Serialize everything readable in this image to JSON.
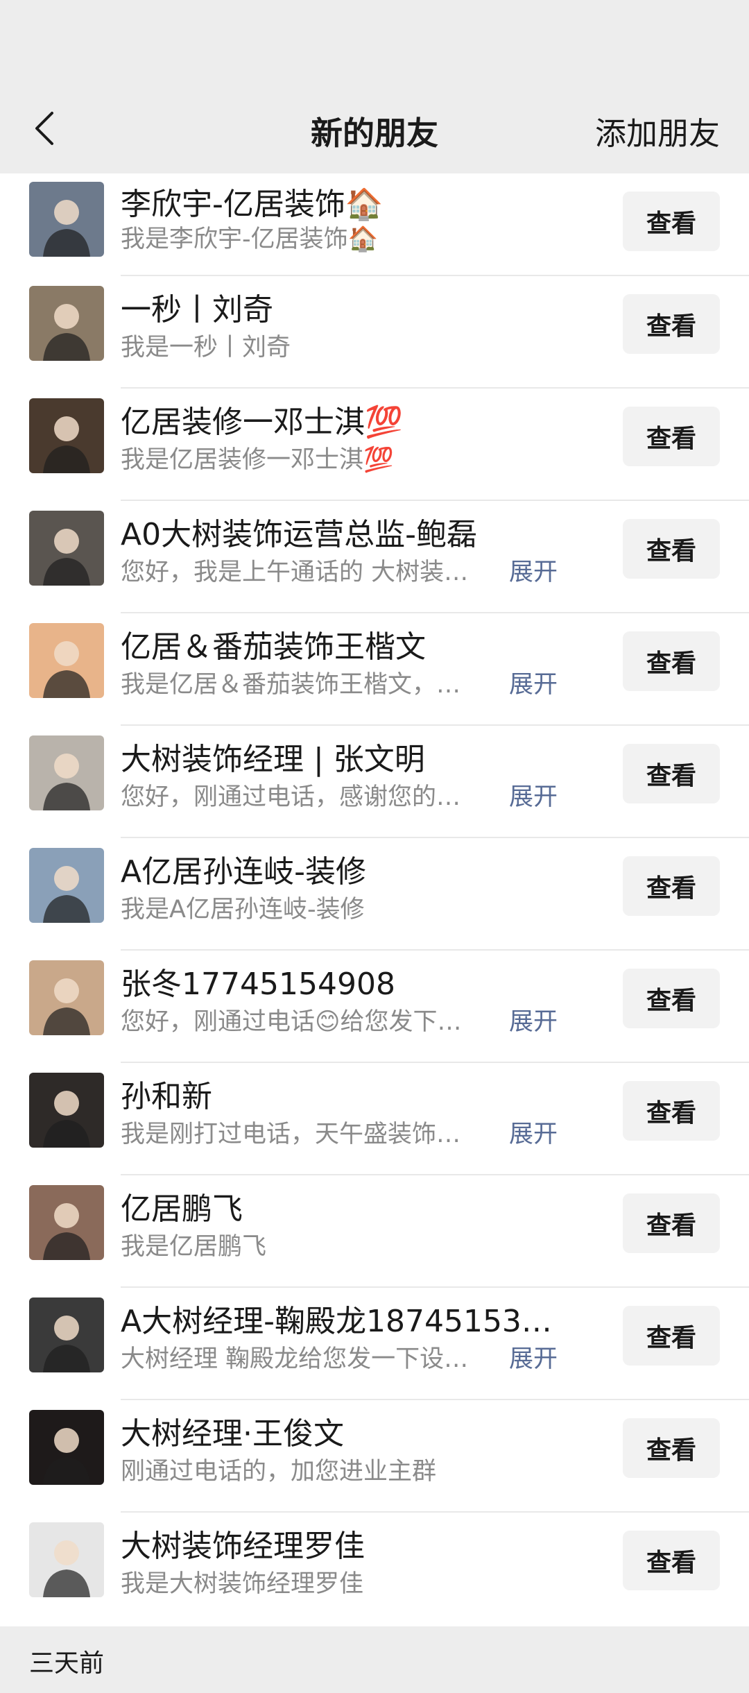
{
  "header": {
    "title": "新的朋友",
    "add_friend_label": "添加朋友"
  },
  "list": {
    "items": [
      {
        "name": "李欣宇-亿居装饰🏠",
        "message": "我是李欣宇-亿居装饰🏠",
        "expand": "",
        "button": "查看",
        "avatar_color": "#6d7a8c"
      },
      {
        "name": "一秒丨刘奇",
        "message": "我是一秒丨刘奇",
        "expand": "",
        "button": "查看",
        "avatar_color": "#8a7a66"
      },
      {
        "name": "亿居装修一邓士淇💯",
        "message": "我是亿居装修一邓士淇💯",
        "expand": "",
        "button": "查看",
        "avatar_color": "#4a3a2e"
      },
      {
        "name": "A0大树装饰运营总监-鲍磊",
        "message": "您好，我是上午通话的 大树装…",
        "expand": "展开",
        "button": "查看",
        "avatar_color": "#5a5550"
      },
      {
        "name": "亿居＆番茄装饰王楷文",
        "message": "我是亿居＆番茄装饰王楷文，…",
        "expand": "展开",
        "button": "查看",
        "avatar_color": "#e8b48a"
      },
      {
        "name": "大树装饰经理 | 张文明",
        "message": "您好，刚通过电话，感谢您的…",
        "expand": "展开",
        "button": "查看",
        "avatar_color": "#b9b3ab"
      },
      {
        "name": "A亿居孙连岐-装修",
        "message": "我是A亿居孙连岐-装修",
        "expand": "",
        "button": "查看",
        "avatar_color": "#8aa0b8"
      },
      {
        "name": "张冬17745154908",
        "message": "您好，刚通过电话😊给您发下…",
        "expand": "展开",
        "button": "查看",
        "avatar_color": "#c9a88a"
      },
      {
        "name": "孙和新",
        "message": "我是刚打过电话，天午盛装饰…",
        "expand": "展开",
        "button": "查看",
        "avatar_color": "#2e2a28"
      },
      {
        "name": "亿居鹏飞",
        "message": "我是亿居鹏飞",
        "expand": "",
        "button": "查看",
        "avatar_color": "#8a6a5a"
      },
      {
        "name": "A大树经理-鞠殿龙18745153…",
        "message": "大树经理 鞠殿龙给您发一下设…",
        "expand": "展开",
        "button": "查看",
        "avatar_color": "#3a3a3a"
      },
      {
        "name": "大树经理·王俊文",
        "message": "刚通过电话的，加您进业主群",
        "expand": "",
        "button": "查看",
        "avatar_color": "#1e1a1a"
      },
      {
        "name": "大树装饰经理罗佳",
        "message": "我是大树装饰经理罗佳",
        "expand": "",
        "button": "查看",
        "avatar_color": "#e6e6e6"
      }
    ]
  },
  "section_footer": {
    "label": "三天前"
  }
}
